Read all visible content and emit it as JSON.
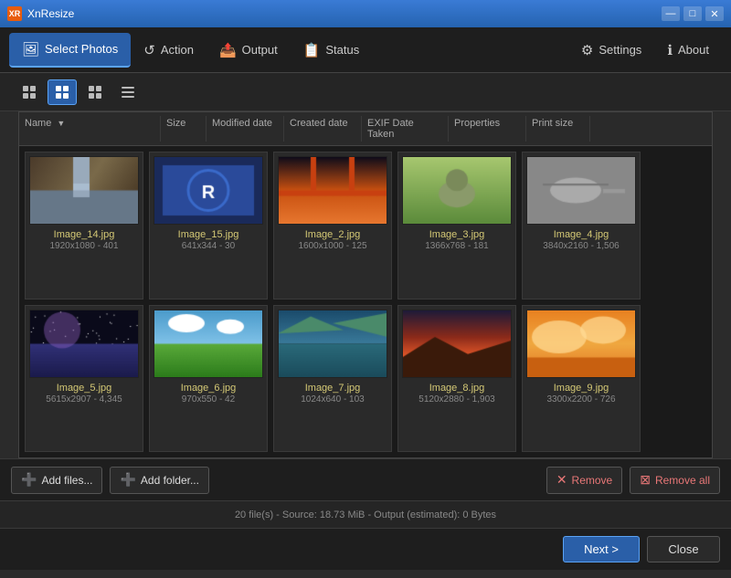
{
  "window": {
    "title": "XnResize",
    "icon": "XR",
    "controls": {
      "minimize": "—",
      "maximize": "□",
      "close": "✕"
    }
  },
  "menu": {
    "items": [
      {
        "id": "select-photos",
        "icon": "🖼",
        "label": "Select Photos",
        "active": true
      },
      {
        "id": "action",
        "icon": "↺",
        "label": "Action",
        "active": false
      },
      {
        "id": "output",
        "icon": "📤",
        "label": "Output",
        "active": false
      },
      {
        "id": "status",
        "icon": "📋",
        "label": "Status",
        "active": false
      }
    ],
    "right_items": [
      {
        "id": "settings",
        "icon": "⚙",
        "label": "Settings"
      },
      {
        "id": "about",
        "icon": "ℹ",
        "label": "About"
      }
    ]
  },
  "toolbar": {
    "view_buttons": [
      {
        "id": "grid-small",
        "icon": "⊞",
        "active": false
      },
      {
        "id": "grid-medium",
        "icon": "⊞",
        "active": true
      },
      {
        "id": "grid-large",
        "icon": "⊞",
        "active": false
      },
      {
        "id": "list",
        "icon": "≡",
        "active": false
      }
    ]
  },
  "file_list": {
    "columns": [
      {
        "id": "name",
        "label": "Name",
        "sortable": true
      },
      {
        "id": "size",
        "label": "Size"
      },
      {
        "id": "modified",
        "label": "Modified date"
      },
      {
        "id": "created",
        "label": "Created date"
      },
      {
        "id": "exif",
        "label": "EXIF Date Taken"
      },
      {
        "id": "properties",
        "label": "Properties"
      },
      {
        "id": "print_size",
        "label": "Print size"
      }
    ],
    "items": [
      {
        "name": "Image_14.jpg",
        "info": "1920x1080 - 401",
        "color1": "#6b5a3a",
        "color2": "#8a7a5a",
        "style": "waterfall"
      },
      {
        "name": "Image_15.jpg",
        "info": "641x344 - 30",
        "color1": "#1a3a8a",
        "color2": "#2a5aba",
        "style": "logo"
      },
      {
        "name": "Image_2.jpg",
        "info": "1600x1000 - 125",
        "color1": "#c85a10",
        "color2": "#e87a30",
        "style": "bridge"
      },
      {
        "name": "Image_3.jpg",
        "info": "1366x768 - 181",
        "color1": "#3a6a2a",
        "color2": "#5a8a4a",
        "style": "animal"
      },
      {
        "name": "Image_4.jpg",
        "info": "3840x2160 - 1,506",
        "color1": "#6a6a6a",
        "color2": "#8a8a8a",
        "style": "helicopter"
      },
      {
        "name": "Image_5.jpg",
        "info": "5615x2907 - 4,345",
        "color1": "#1a1a3a",
        "color2": "#3a3a6a",
        "style": "stars"
      },
      {
        "name": "Image_6.jpg",
        "info": "970x550 - 42",
        "color1": "#2a6a2a",
        "color2": "#4a8a4a",
        "style": "meadow"
      },
      {
        "name": "Image_7.jpg",
        "info": "1024x640 - 103",
        "color1": "#1a4a6a",
        "color2": "#3a7a9a",
        "style": "lake"
      },
      {
        "name": "Image_8.jpg",
        "info": "5120x2880 - 1,903",
        "color1": "#c84a2a",
        "color2": "#e87a5a",
        "style": "sunset"
      },
      {
        "name": "Image_9.jpg",
        "info": "3300x2200 - 726",
        "color1": "#e88a20",
        "color2": "#f0aa40",
        "style": "clouds"
      }
    ]
  },
  "bottom": {
    "add_files": "Add files...",
    "add_folder": "Add folder...",
    "remove": "Remove",
    "remove_all": "Remove all"
  },
  "status": {
    "text": "20 file(s) - Source: 18.73 MiB - Output (estimated): 0 Bytes"
  },
  "footer": {
    "next": "Next >",
    "close": "Close"
  }
}
